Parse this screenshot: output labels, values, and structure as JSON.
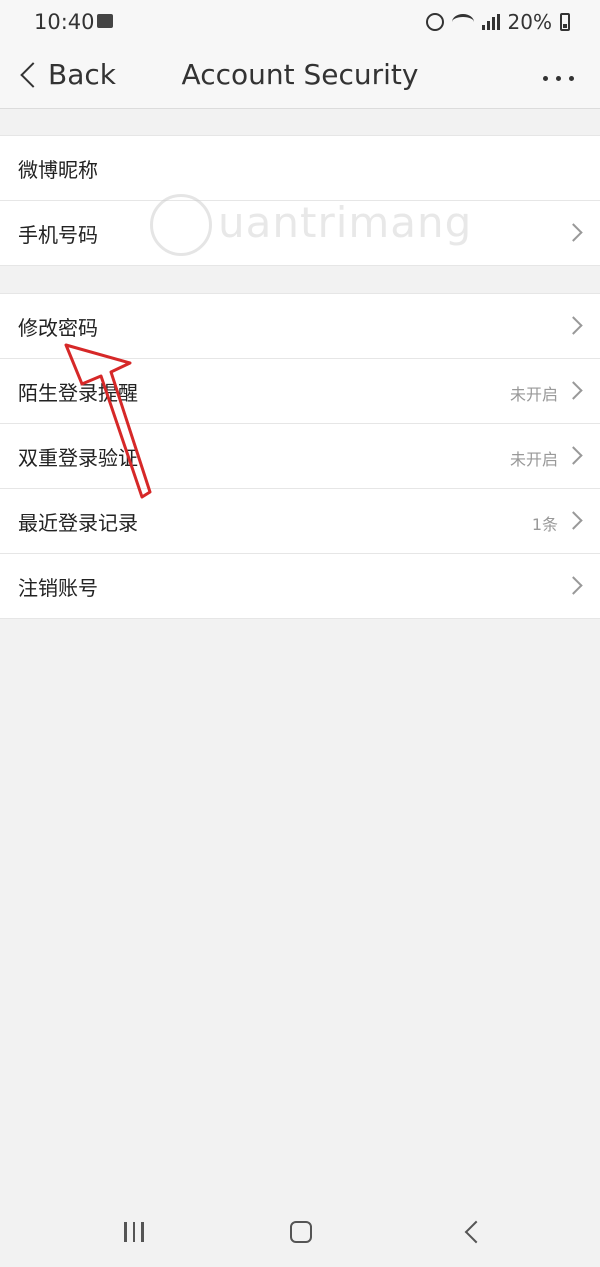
{
  "status_bar": {
    "time": "10:40",
    "battery": "20%"
  },
  "nav": {
    "back_label": "Back",
    "title": "Account Security"
  },
  "groups": [
    {
      "rows": [
        {
          "label": "微博昵称",
          "value": ""
        },
        {
          "label": "手机号码",
          "value": ""
        }
      ]
    },
    {
      "rows": [
        {
          "label": "修改密码",
          "value": ""
        },
        {
          "label": "陌生登录提醒",
          "value": "未开启"
        },
        {
          "label": "双重登录验证",
          "value": "未开启"
        },
        {
          "label": "最近登录记录",
          "value": "1条"
        },
        {
          "label": "注销账号",
          "value": ""
        }
      ]
    }
  ],
  "watermark": {
    "text": "uantrimang"
  },
  "colors": {
    "annotation_arrow": "#d62828",
    "background": "#f2f2f2"
  }
}
